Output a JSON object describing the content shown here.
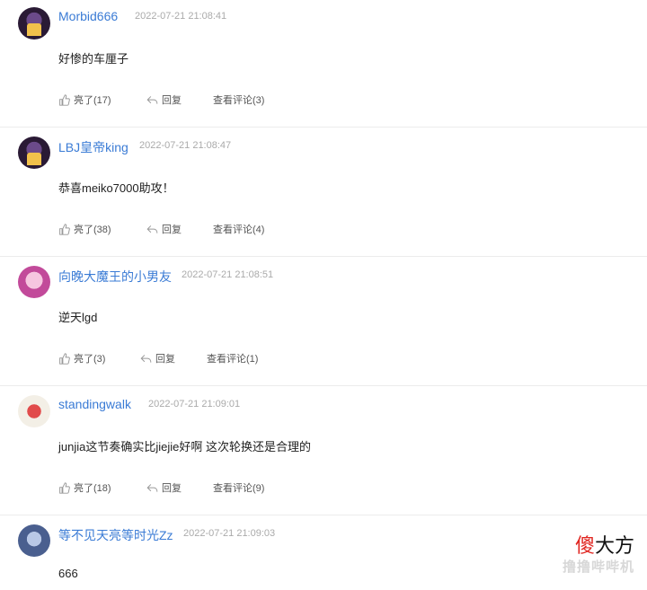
{
  "comments": [
    {
      "username": "Morbid666",
      "time": "2022-07-21 21:08:41",
      "content": "好惨的车厘子",
      "like_label": "亮了(17)",
      "reply_label": "回复",
      "view_label": "查看评论(3)"
    },
    {
      "username": "LBJ皇帝king",
      "time": "2022-07-21 21:08:47",
      "content": "恭喜meiko7000助攻！",
      "like_label": "亮了(38)",
      "reply_label": "回复",
      "view_label": "查看评论(4)"
    },
    {
      "username": "向晚大魔王的小男友",
      "time": "2022-07-21 21:08:51",
      "content": "逆天lgd",
      "like_label": "亮了(3)",
      "reply_label": "回复",
      "view_label": "查看评论(1)"
    },
    {
      "username": "standingwalk",
      "time": "2022-07-21 21:09:01",
      "content": "junjia这节奏确实比jiejie好啊 这次轮换还是合理的",
      "like_label": "亮了(18)",
      "reply_label": "回复",
      "view_label": "查看评论(9)"
    },
    {
      "username": "等不见天亮等时光Zz",
      "time": "2022-07-21 21:09:03",
      "content": "666"
    }
  ],
  "watermark": {
    "title_red": "傻",
    "title_rest": "大方",
    "subtitle": "撸撸哔哔机"
  },
  "icons": {
    "like": "thumbs-up-icon",
    "reply": "reply-arrow-icon"
  },
  "colors": {
    "username": "#3a7bd5",
    "timestamp": "#aaaaaa",
    "watermark_red": "#e0241f"
  }
}
